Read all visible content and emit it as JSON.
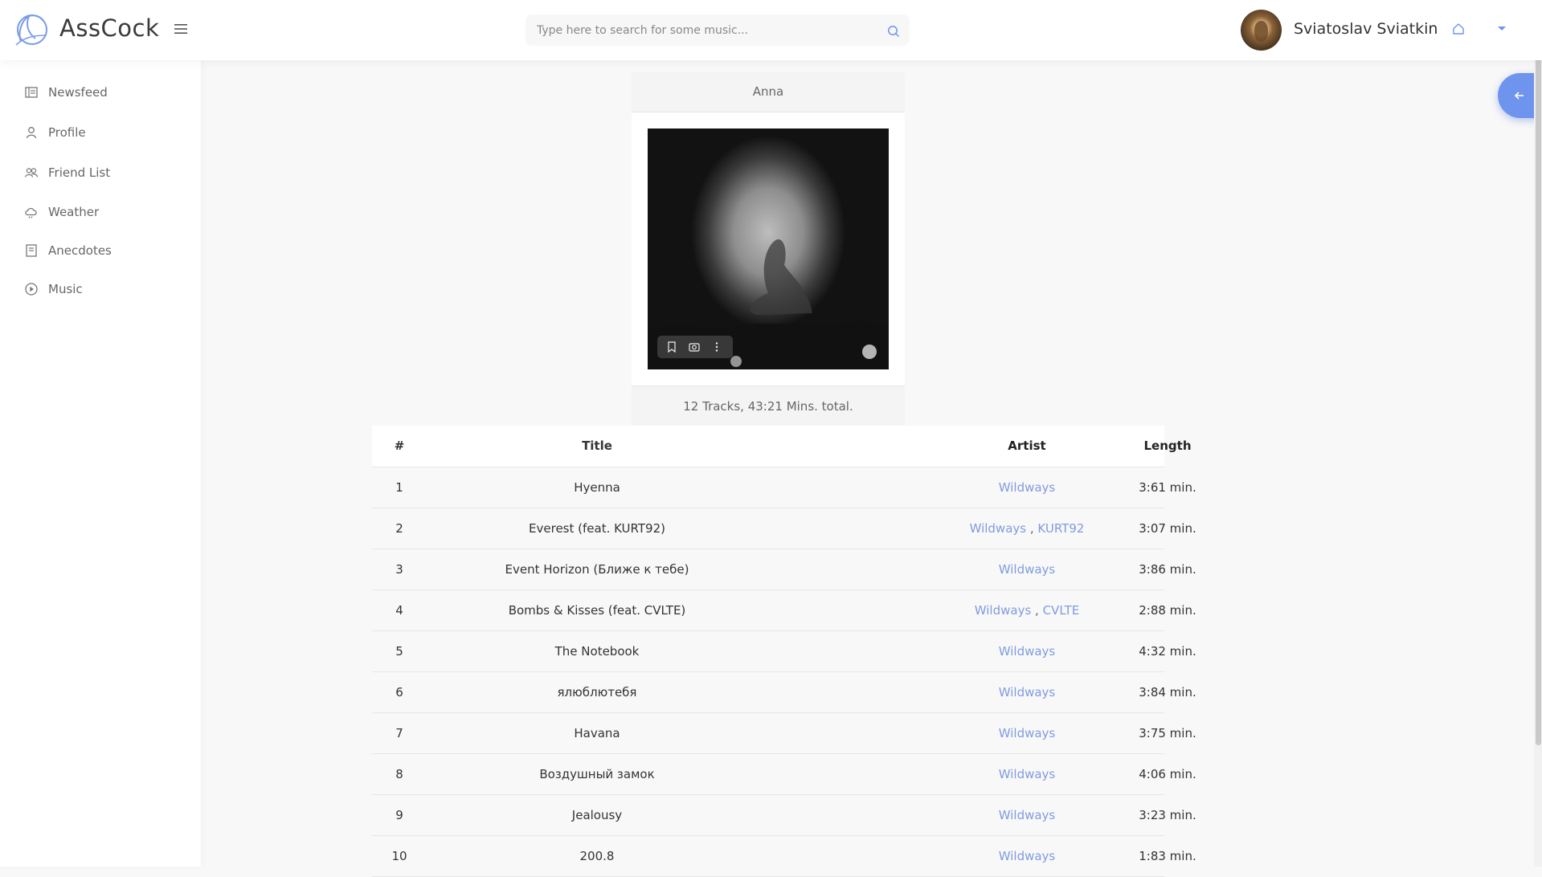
{
  "brand": {
    "name": "AssCock"
  },
  "search": {
    "placeholder": "Type here to search for some music..."
  },
  "user": {
    "name": "Sviatoslav Sviatkin"
  },
  "sidebar": {
    "items": [
      {
        "label": "Newsfeed",
        "icon": "newsfeed-icon"
      },
      {
        "label": "Profile",
        "icon": "profile-icon"
      },
      {
        "label": "Friend List",
        "icon": "friends-icon"
      },
      {
        "label": "Weather",
        "icon": "weather-icon"
      },
      {
        "label": "Anecdotes",
        "icon": "anecdotes-icon"
      },
      {
        "label": "Music",
        "icon": "play-circle-icon"
      }
    ]
  },
  "album": {
    "title": "Anna",
    "summary": "12 Tracks, 43:21 Mins. total."
  },
  "table": {
    "headers": {
      "num": "#",
      "title": "Title",
      "artist": "Artist",
      "length": "Length"
    },
    "rows": [
      {
        "num": "1",
        "title": "Hyenna",
        "artists": [
          "Wildways"
        ],
        "length": "3:61 min."
      },
      {
        "num": "2",
        "title": "Everest (feat. KURT92)",
        "artists": [
          "Wildways",
          "KURT92"
        ],
        "length": "3:07 min."
      },
      {
        "num": "3",
        "title": "Event Horizon (Ближе к тебе)",
        "artists": [
          "Wildways"
        ],
        "length": "3:86 min."
      },
      {
        "num": "4",
        "title": "Bombs & Kisses (feat. CVLTE)",
        "artists": [
          "Wildways",
          "CVLTE"
        ],
        "length": "2:88 min."
      },
      {
        "num": "5",
        "title": "The Notebook",
        "artists": [
          "Wildways"
        ],
        "length": "4:32 min."
      },
      {
        "num": "6",
        "title": "ялюблютебя",
        "artists": [
          "Wildways"
        ],
        "length": "3:84 min."
      },
      {
        "num": "7",
        "title": "Havana",
        "artists": [
          "Wildways"
        ],
        "length": "3:75 min."
      },
      {
        "num": "8",
        "title": "Воздушный замок",
        "artists": [
          "Wildways"
        ],
        "length": "4:06 min."
      },
      {
        "num": "9",
        "title": "Jealousy",
        "artists": [
          "Wildways"
        ],
        "length": "3:23 min."
      },
      {
        "num": "10",
        "title": "200.8",
        "artists": [
          "Wildways"
        ],
        "length": "1:83 min."
      }
    ]
  },
  "colors": {
    "accent": "#6f94ee",
    "link": "#7f9be0",
    "background": "#f8f8f8"
  }
}
